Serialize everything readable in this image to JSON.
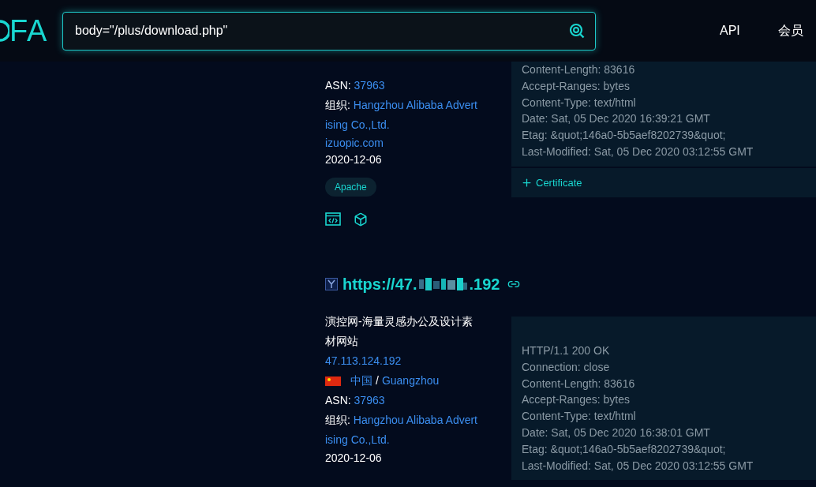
{
  "header": {
    "logo": "FA",
    "search": {
      "value": "body=\"/plus/download.php\""
    },
    "nav": [
      "API",
      "会员"
    ]
  },
  "results": [
    {
      "asn_label": "ASN:",
      "asn": "37963",
      "org_label": "组织:",
      "org": "Hangzhou Alibaba Advert",
      "org_cont": "ising Co.,Ltd.",
      "domain": "izuopic.com",
      "date": "2020-12-06",
      "tags": [
        "Apache"
      ],
      "headers": [
        "Content-Length: 83616",
        "Accept-Ranges: bytes",
        "Content-Type: text/html",
        "Date: Sat, 05 Dec 2020 16:39:21 GMT",
        "Etag: &quot;146a0-5b5aef8202739&quot;",
        "Last-Modified: Sat, 05 Dec 2020 03:12:55 GMT"
      ],
      "certificate": "Certificate"
    },
    {
      "title_prefix": "https://47.",
      "title_suffix": ".192",
      "description": "演控网-海量灵感办公及设计素材网站",
      "ip": "47.113.124.192",
      "country": "中国",
      "separator": "/",
      "city": "Guangzhou",
      "asn_label": "ASN:",
      "asn": "37963",
      "org_label": "组织:",
      "org": "Hangzhou Alibaba Advert",
      "org_cont": "ising Co.,Ltd.",
      "date": "2020-12-06",
      "headers": [
        "HTTP/1.1 200 OK",
        "Connection: close",
        "Content-Length: 83616",
        "Accept-Ranges: bytes",
        "Content-Type: text/html",
        "Date: Sat, 05 Dec 2020 16:38:01 GMT",
        "Etag: &quot;146a0-5b5aef8202739&quot;",
        "Last-Modified: Sat, 05 Dec 2020 03:12:55 GMT"
      ]
    }
  ]
}
